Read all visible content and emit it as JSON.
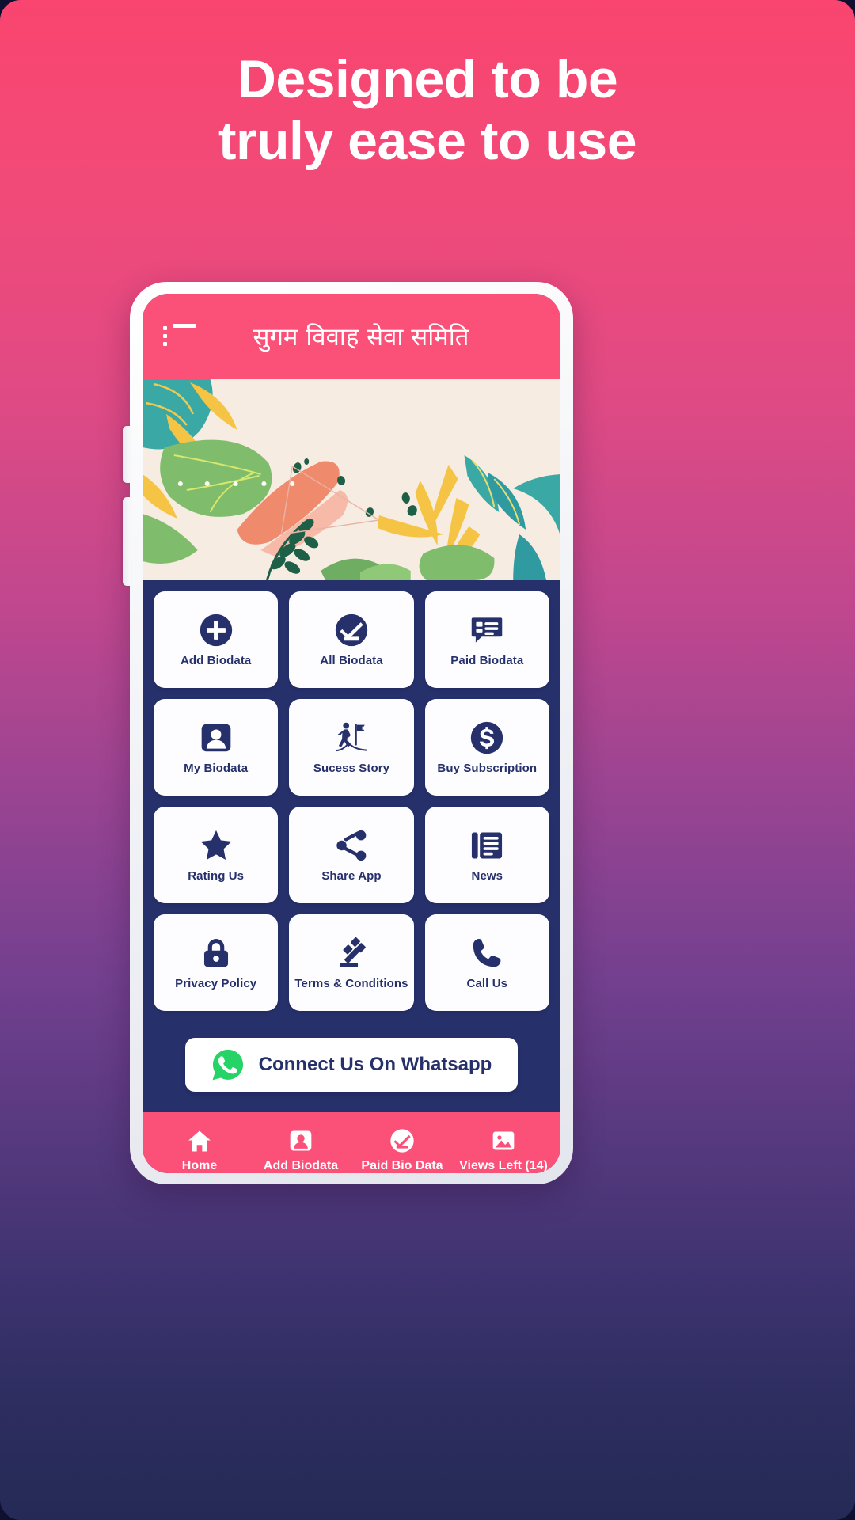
{
  "promo": {
    "headline_line1": "Designed to be",
    "headline_line2": "truly ease to use",
    "bg_top_color": "#f9456f",
    "bg_bottom_color": "#242a55"
  },
  "app": {
    "header": {
      "menu_icon": "list-menu-icon",
      "title": "सुगम विवाह सेवा समिति",
      "bar_color": "#fb5179"
    },
    "banner": {
      "alt": "tropical-leaves-banner",
      "background_color": "#f6ece1"
    },
    "grid": {
      "background_color": "#26306b",
      "tile_color": "#fdfdff",
      "tile_text_color": "#26306b",
      "tiles": [
        {
          "label": "Add Biodata",
          "icon": "plus-circle-icon"
        },
        {
          "label": "All Biodata",
          "icon": "check-circle-icon"
        },
        {
          "label": "Paid Biodata",
          "icon": "paid-list-icon"
        },
        {
          "label": "My Biodata",
          "icon": "person-card-icon"
        },
        {
          "label": "Sucess Story",
          "icon": "flag-summit-icon"
        },
        {
          "label": "Buy Subscription",
          "icon": "dollar-circle-icon"
        },
        {
          "label": "Rating Us",
          "icon": "star-icon"
        },
        {
          "label": "Share App",
          "icon": "share-nodes-icon"
        },
        {
          "label": "News",
          "icon": "newspaper-icon"
        },
        {
          "label": "Privacy Policy",
          "icon": "lock-icon"
        },
        {
          "label": "Terms & Conditions",
          "icon": "gavel-icon"
        },
        {
          "label": "Call Us",
          "icon": "phone-icon"
        }
      ]
    },
    "whatsapp": {
      "label": "Connect Us On Whatsapp",
      "icon": "whatsapp-icon",
      "icon_color": "#25D366"
    },
    "bottom_nav": {
      "bar_color": "#fb5179",
      "items": [
        {
          "label": "Home",
          "icon": "home-icon"
        },
        {
          "label": "Add Biodata",
          "icon": "person-card-icon"
        },
        {
          "label": "Paid Bio Data",
          "icon": "check-circle-icon"
        },
        {
          "label": "Views Left (14)",
          "icon": "image-icon"
        }
      ]
    }
  }
}
